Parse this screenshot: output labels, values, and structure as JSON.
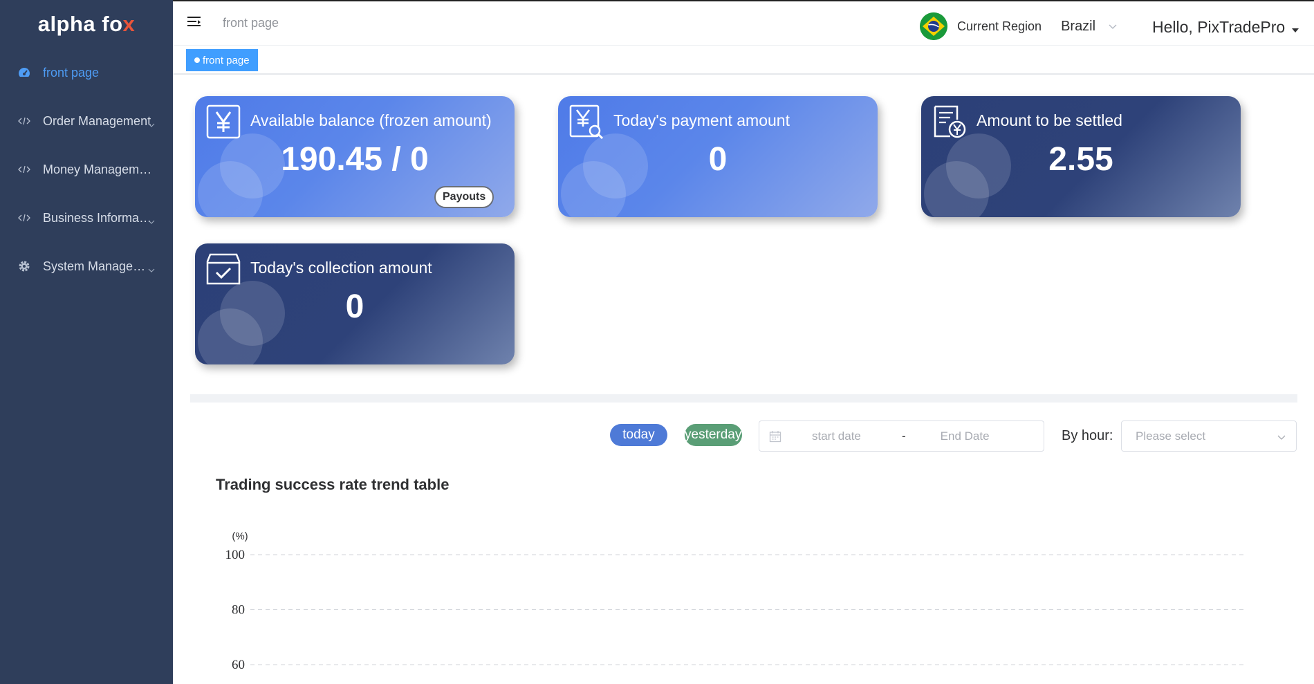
{
  "brand": {
    "text": "alpha fo",
    "accent": "x"
  },
  "sidebar": {
    "items": [
      {
        "label": "front page",
        "icon": "dashboard-icon",
        "active": true
      },
      {
        "label": "Order Management",
        "icon": "code-icon"
      },
      {
        "label": "Money Management",
        "icon": "code-icon"
      },
      {
        "label": "Business Informati...",
        "icon": "code-icon"
      },
      {
        "label": "System Managem...",
        "icon": "gear-icon"
      }
    ]
  },
  "topbar": {
    "breadcrumb": "front page",
    "region_label": "Current Region",
    "region_value": "Brazil",
    "user_greeting": "Hello, PixTradePro"
  },
  "tags": {
    "active": "front page"
  },
  "cards": [
    {
      "title": "Available balance (frozen amount)",
      "value": "190.45 / 0",
      "button": "Payouts",
      "icon": "yen-icon"
    },
    {
      "title": "Today's payment amount",
      "value": "0",
      "icon": "yen-search-icon"
    },
    {
      "title": "Amount to be settled",
      "value": "2.55",
      "icon": "invoice-yen-icon"
    },
    {
      "title": "Today's collection amount",
      "value": "0",
      "icon": "inbox-check-icon"
    }
  ],
  "filters": {
    "today": "today",
    "yesterday": "yesterday",
    "start_date": "start date",
    "separator": "-",
    "end_date": "End Date",
    "by_hour_label": "By hour:",
    "select_placeholder": "Please select"
  },
  "chart_data": {
    "type": "line",
    "title": "Trading success rate trend table",
    "ylabel": "(%)",
    "y_ticks": [
      "100",
      "80",
      "60"
    ],
    "ylim": [
      60,
      100
    ],
    "series": [],
    "grid": true
  },
  "colors": {
    "sidebar_bg": "#2f3e5b",
    "active": "#4e9cf5",
    "tag": "#409eff",
    "card_light": "#5b86ea",
    "card_dark": "#2e4279",
    "today_pill": "#4e7ad7",
    "yesterday_pill": "#5a9e76"
  }
}
